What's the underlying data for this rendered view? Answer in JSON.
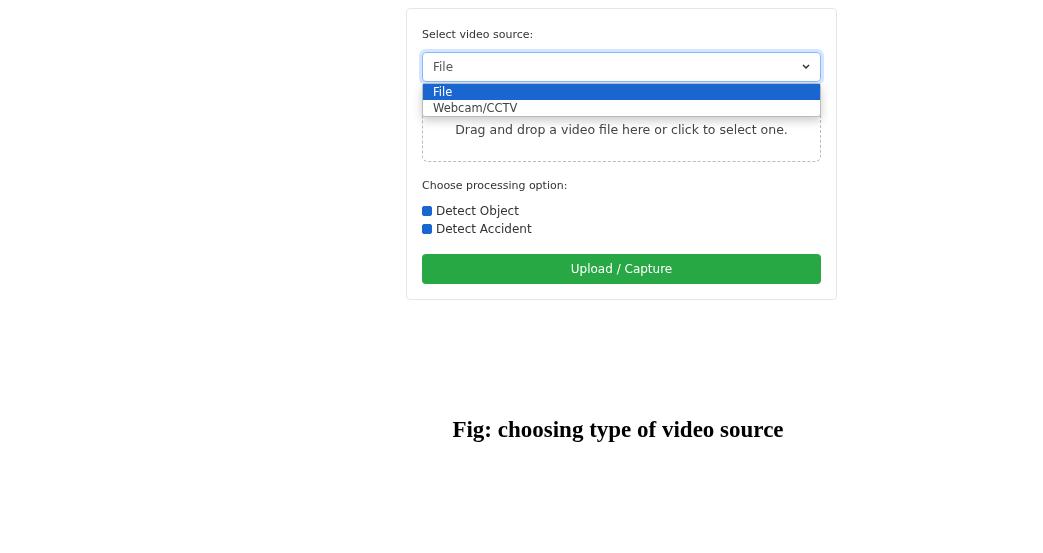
{
  "form": {
    "source_label": "Select video source:",
    "source_value": "File",
    "source_options": [
      {
        "label": "File",
        "selected": true
      },
      {
        "label": "Webcam/CCTV",
        "selected": false
      }
    ],
    "drop_zone": "Drag and drop a video file here or click to select one.",
    "options_label": "Choose processing option:",
    "checkboxes": [
      {
        "label": "Detect Object",
        "checked": true
      },
      {
        "label": "Detect Accident",
        "checked": true
      }
    ],
    "submit_button": "Upload / Capture"
  },
  "caption": "Fig: choosing type of video source"
}
